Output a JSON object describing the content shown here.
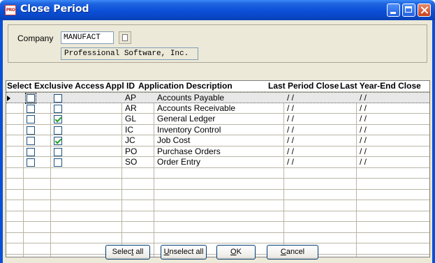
{
  "window": {
    "title": "Close Period",
    "app_badge": "PRO",
    "accent_color": "#0a4fd7"
  },
  "company": {
    "label": "Company",
    "code": "MANUFACT",
    "name": "Professional Software, Inc.",
    "lookup_icon": "lookup-icon"
  },
  "grid": {
    "columns": {
      "select": "Select",
      "exclusive": "Exclusive Access",
      "appl_id": "Appl ID",
      "description": "Application Description",
      "last_period": "Last Period Close",
      "last_year": "Last Year-End Close"
    },
    "rows": [
      {
        "select": false,
        "exclusive": false,
        "appl_id": "AP",
        "description": "Accounts Payable",
        "last_period": "/ /",
        "last_year": "/ /"
      },
      {
        "select": false,
        "exclusive": false,
        "appl_id": "AR",
        "description": "Accounts Receivable",
        "last_period": "/ /",
        "last_year": "/ /"
      },
      {
        "select": false,
        "exclusive": true,
        "appl_id": "GL",
        "description": "General Ledger",
        "last_period": "/ /",
        "last_year": "/ /"
      },
      {
        "select": false,
        "exclusive": false,
        "appl_id": "IC",
        "description": "Inventory Control",
        "last_period": "/ /",
        "last_year": "/ /"
      },
      {
        "select": false,
        "exclusive": true,
        "appl_id": "JC",
        "description": "Job Cost",
        "last_period": "/ /",
        "last_year": "/ /"
      },
      {
        "select": false,
        "exclusive": false,
        "appl_id": "PO",
        "description": "Purchase Orders",
        "last_period": "/ /",
        "last_year": "/ /"
      },
      {
        "select": false,
        "exclusive": false,
        "appl_id": "SO",
        "description": "Order Entry",
        "last_period": "/ /",
        "last_year": "/ /"
      }
    ]
  },
  "buttons": {
    "select_all": {
      "before": "Selec",
      "mnemonic": "t",
      "after": " all"
    },
    "unselect_all": {
      "before": "",
      "mnemonic": "U",
      "after": "nselect all"
    },
    "ok": {
      "before": "",
      "mnemonic": "O",
      "after": "K"
    },
    "cancel": {
      "before": "",
      "mnemonic": "C",
      "after": "ancel"
    }
  }
}
